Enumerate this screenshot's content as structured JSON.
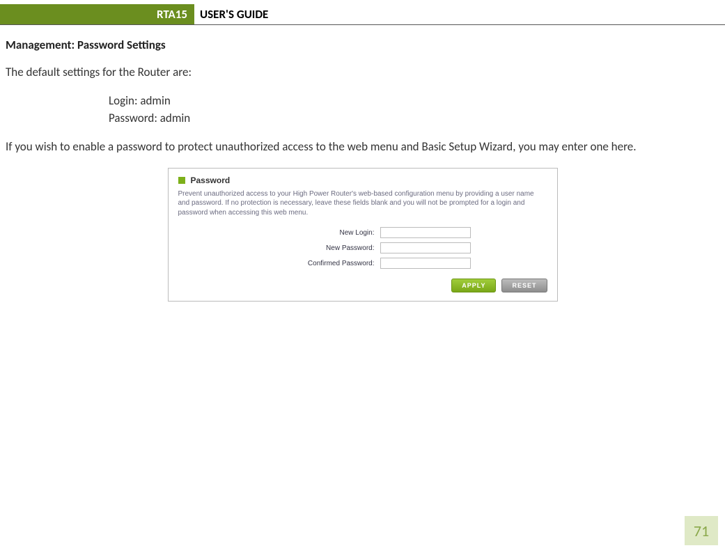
{
  "header": {
    "model": "RTA15",
    "title": "USER'S GUIDE"
  },
  "section": {
    "heading": "Management: Password Settings",
    "intro": "The default settings for the Router are:",
    "defaults": {
      "login": "Login: admin",
      "password": "Password: admin"
    },
    "body": "If you wish to enable a password to protect unauthorized access to the web menu and Basic Setup Wizard, you may enter one here."
  },
  "panel": {
    "title": "Password",
    "description": "Prevent unauthorized access to your High Power Router's web-based configuration menu by providing a user name and password. If no protection is necessary, leave these fields blank and you will not be prompted for a login and password when accessing this web menu.",
    "fields": {
      "new_login_label": "New Login:",
      "new_password_label": "New Password:",
      "confirmed_password_label": "Confirmed Password:",
      "new_login_value": "",
      "new_password_value": "",
      "confirmed_password_value": ""
    },
    "buttons": {
      "apply": "APPLY",
      "reset": "RESET"
    }
  },
  "page_number": "71"
}
